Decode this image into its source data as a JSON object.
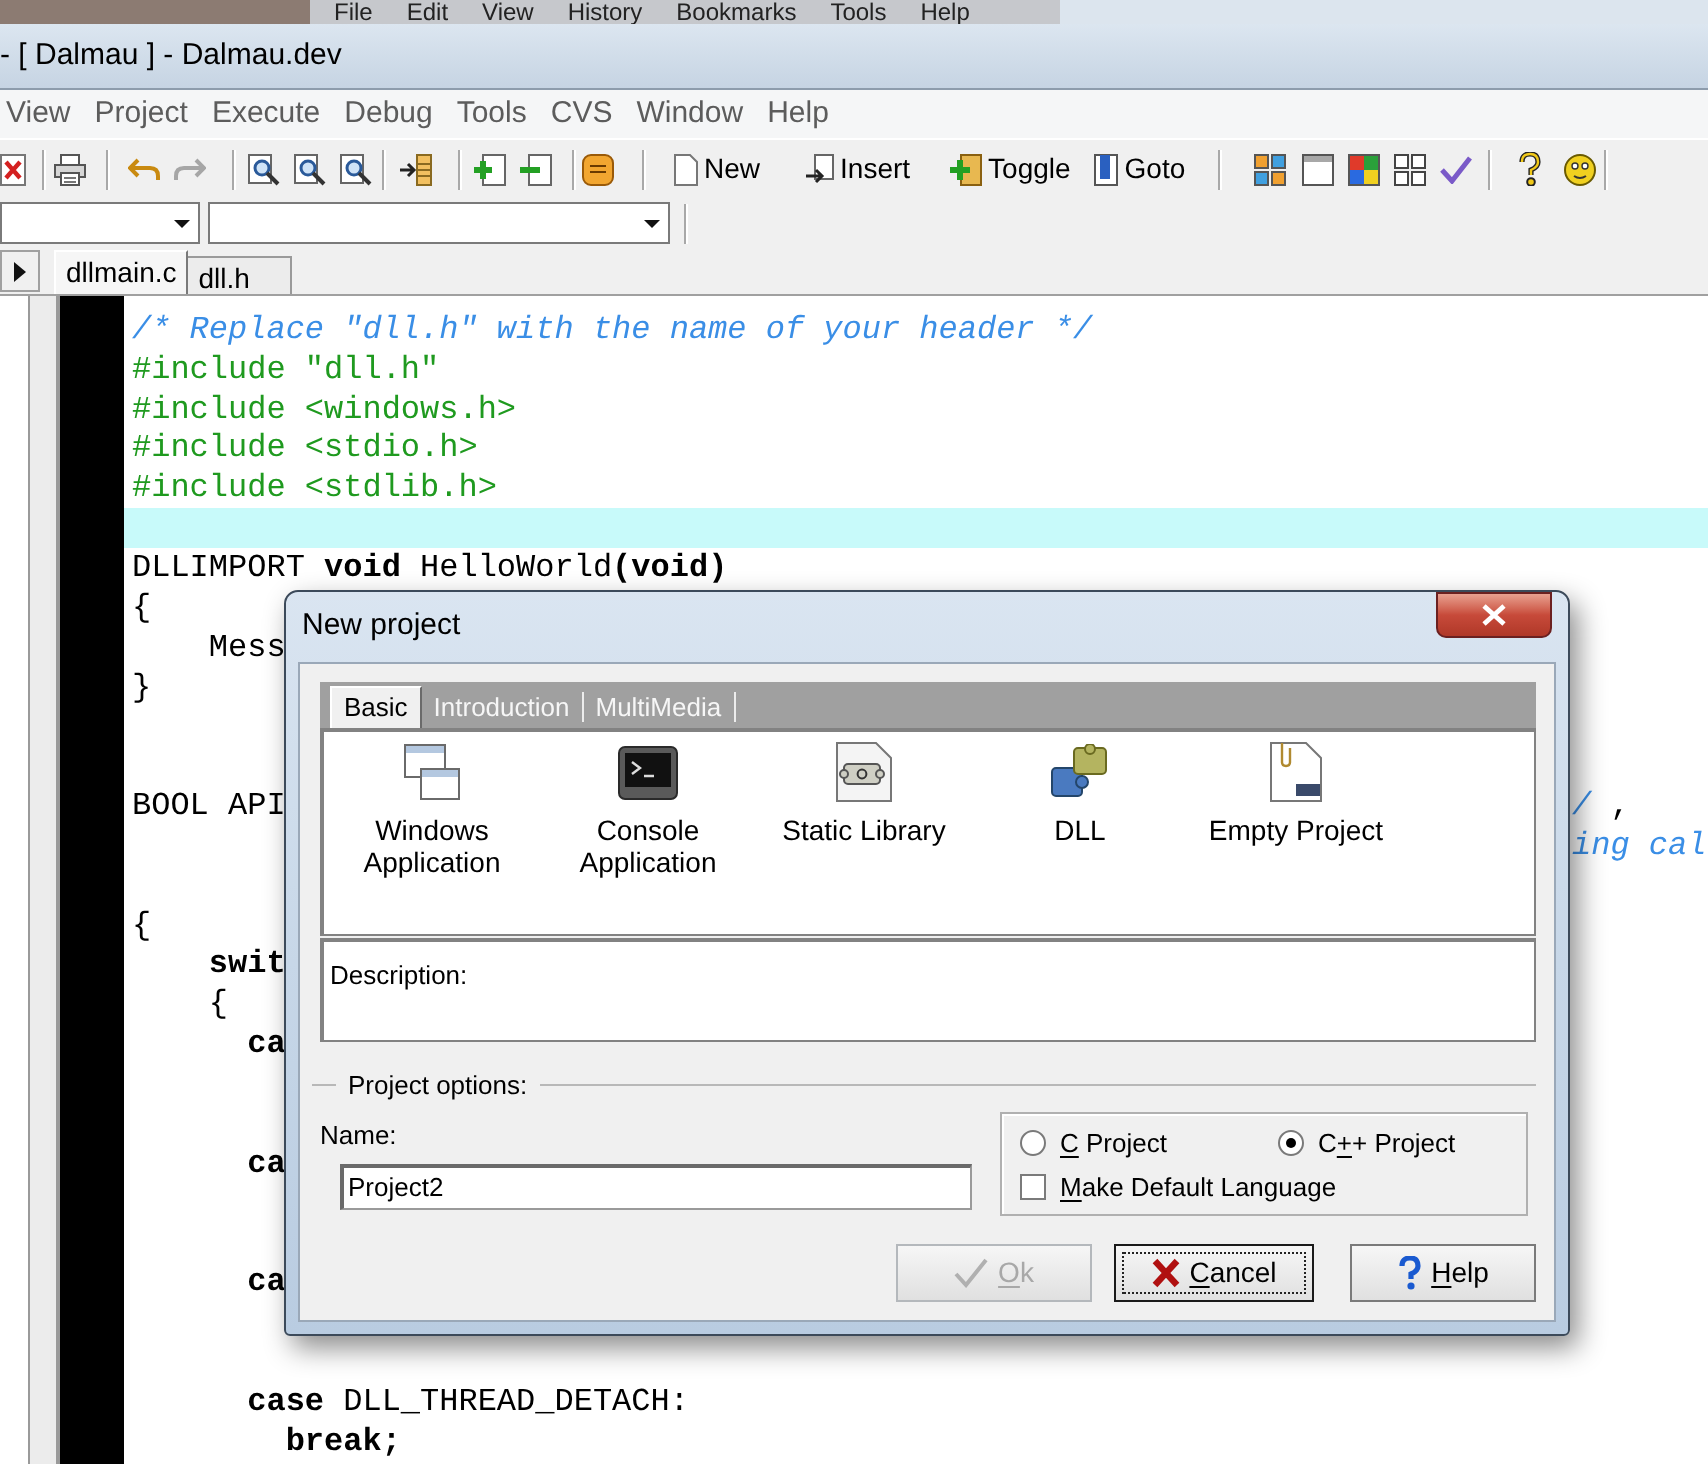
{
  "browser_menu": [
    "File",
    "Edit",
    "View",
    "History",
    "Bookmarks",
    "Tools",
    "Help"
  ],
  "window": {
    "title": "- [ Dalmau ] - Dalmau.dev"
  },
  "menu": [
    "View",
    "Project",
    "Execute",
    "Debug",
    "Tools",
    "CVS",
    "Window",
    "Help"
  ],
  "toolbar": {
    "history_buttons": [
      {
        "kind": "undo",
        "disabled": false
      },
      {
        "kind": "redo",
        "disabled": true
      }
    ],
    "text_buttons": [
      {
        "kind": "new",
        "label": "New"
      },
      {
        "kind": "insert",
        "label": "Insert"
      },
      {
        "kind": "toggle",
        "label": "Toggle"
      },
      {
        "kind": "goto",
        "label": "Goto"
      }
    ]
  },
  "editor": {
    "tabs": [
      {
        "label": "dllmain.c",
        "selected": true
      },
      {
        "label": "dll.h",
        "selected": false
      }
    ],
    "lines": [
      {
        "current": false,
        "tokens": [
          {
            "kind": "comment",
            "text": "/* Replace \"dll.h\" with the name of your header */"
          }
        ]
      },
      {
        "current": false,
        "tokens": [
          {
            "kind": "directive",
            "text": "#include \"dll.h\""
          }
        ]
      },
      {
        "current": false,
        "tokens": [
          {
            "kind": "directive",
            "text": "#include <windows.h>"
          }
        ]
      },
      {
        "current": false,
        "tokens": [
          {
            "kind": "directive",
            "text": "#include <stdio.h>"
          }
        ]
      },
      {
        "current": false,
        "tokens": [
          {
            "kind": "directive",
            "text": "#include <stdlib.h>"
          }
        ]
      },
      {
        "current": true
      },
      {
        "current": false,
        "tokens": [
          {
            "kind": "plain",
            "text": "DLLIMPORT "
          },
          {
            "kind": "keyword",
            "text": "void"
          },
          {
            "kind": "plain",
            "text": " HelloWorld"
          },
          {
            "kind": "symbol",
            "text": "("
          },
          {
            "kind": "keyword",
            "text": "void"
          },
          {
            "kind": "symbol",
            "text": ")"
          }
        ]
      },
      {
        "current": false,
        "tokens": [
          {
            "kind": "plain",
            "text": "{"
          }
        ]
      },
      {
        "current": false,
        "tokens": [
          {
            "kind": "plain",
            "text": "    Mess"
          }
        ]
      },
      {
        "current": false,
        "tokens": [
          {
            "kind": "plain",
            "text": "}"
          }
        ]
      },
      {
        "current": false
      },
      {
        "current": false
      },
      {
        "current": false,
        "tokens": [
          {
            "kind": "plain",
            "text": "BOOL API"
          }
        ],
        "tail_tokens": [
          {
            "kind": "comment",
            "text": "/"
          },
          {
            "kind": "plain",
            "text": " ,"
          }
        ]
      },
      {
        "current": false,
        "tail_tokens": [
          {
            "kind": "comment",
            "text": "ing cal"
          }
        ]
      },
      {
        "current": false
      },
      {
        "current": false,
        "tokens": [
          {
            "kind": "plain",
            "text": "{"
          }
        ]
      },
      {
        "current": false,
        "tokens": [
          {
            "kind": "keyword",
            "text": "    swit"
          }
        ]
      },
      {
        "current": false,
        "tokens": [
          {
            "kind": "plain",
            "text": "    {"
          }
        ]
      },
      {
        "current": false,
        "tokens": [
          {
            "kind": "keyword",
            "text": "      ca"
          }
        ]
      },
      {
        "current": false
      },
      {
        "current": false
      },
      {
        "current": false,
        "tokens": [
          {
            "kind": "keyword",
            "text": "      ca"
          }
        ]
      },
      {
        "current": false
      },
      {
        "current": false
      },
      {
        "current": false,
        "tokens": [
          {
            "kind": "keyword",
            "text": "      ca"
          }
        ]
      },
      {
        "current": false
      },
      {
        "current": false
      },
      {
        "current": false,
        "tokens": [
          {
            "kind": "keyword",
            "text": "      case"
          },
          {
            "kind": "plain",
            "text": " DLL_THREAD_DETACH:"
          }
        ]
      },
      {
        "current": false,
        "tokens": [
          {
            "kind": "keyword",
            "text": "        break"
          },
          {
            "kind": "symbol",
            "text": ";"
          }
        ]
      }
    ]
  },
  "dialog": {
    "title": "New project",
    "tabs": [
      {
        "label": "Basic",
        "selected": true
      },
      {
        "label": "Introduction",
        "selected": false
      },
      {
        "label": "MultiMedia",
        "selected": false
      }
    ],
    "templates": [
      {
        "kind": "gui",
        "label": "Windows Application"
      },
      {
        "kind": "console",
        "label": "Console Application"
      },
      {
        "kind": "static_library",
        "label": "Static Library"
      },
      {
        "kind": "dll",
        "label": "DLL"
      },
      {
        "kind": "empty",
        "label": "Empty Project"
      }
    ],
    "description_label": "Description:",
    "options": {
      "legend": "Project options:",
      "name_label": "Name:",
      "name_value": "Project2",
      "languages": [
        {
          "label": {
            "key": "C",
            "after": " Project"
          },
          "selected": false
        },
        {
          "label": {
            "before": "C",
            "key": "+",
            "after": "+ Project"
          },
          "selected": true
        }
      ],
      "default_language": {
        "label": {
          "key": "M",
          "after": "ake Default Language"
        },
        "checked": false
      }
    },
    "buttons": [
      {
        "kind": "ok",
        "label": {
          "key": "O",
          "after": "k"
        },
        "disabled": true,
        "focused": false
      },
      {
        "kind": "cancel",
        "label": {
          "key": "C",
          "after": "ancel"
        },
        "disabled": false,
        "focused": true
      },
      {
        "kind": "help",
        "label": {
          "key": "H",
          "after": "elp"
        },
        "disabled": false,
        "focused": false
      }
    ]
  }
}
